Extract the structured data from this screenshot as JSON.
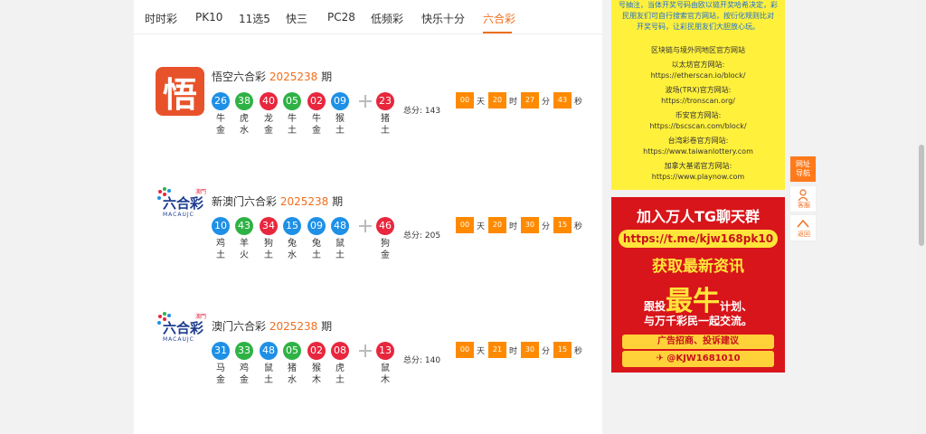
{
  "tabs": [
    {
      "label": "时时彩"
    },
    {
      "label": "PK10"
    },
    {
      "label": "11选5"
    },
    {
      "label": "快三"
    },
    {
      "label": "PC28"
    },
    {
      "label": "低频彩"
    },
    {
      "label": "快乐十分"
    },
    {
      "label": "六合彩"
    }
  ],
  "lotteries": [
    {
      "logo": "悟",
      "name": "悟空六合彩",
      "issue": "2025238",
      "period_label": "期",
      "balls": [
        {
          "num": "26",
          "color": "blue",
          "zodiac": "牛",
          "element": "金"
        },
        {
          "num": "38",
          "color": "green",
          "zodiac": "虎",
          "element": "水"
        },
        {
          "num": "40",
          "color": "red",
          "zodiac": "龙",
          "element": "金"
        },
        {
          "num": "05",
          "color": "green",
          "zodiac": "牛",
          "element": "土"
        },
        {
          "num": "02",
          "color": "red",
          "zodiac": "牛",
          "element": "金"
        },
        {
          "num": "09",
          "color": "blue",
          "zodiac": "猴",
          "element": "土"
        }
      ],
      "special": {
        "num": "23",
        "color": "red",
        "zodiac": "猪",
        "element": "土"
      },
      "total": "总分: 143",
      "countdown": {
        "d": "00",
        "d_u": "天",
        "h": "20",
        "h_u": "时",
        "m": "27",
        "m_u": "分",
        "s": "43",
        "s_u": "秒"
      }
    },
    {
      "logo_text": "六合彩",
      "logo_sub": "MACAUJC",
      "logo_tag": "澳門",
      "name": "新澳门六合彩",
      "issue": "2025238",
      "period_label": "期",
      "balls": [
        {
          "num": "10",
          "color": "blue",
          "zodiac": "鸡",
          "element": "土"
        },
        {
          "num": "43",
          "color": "green",
          "zodiac": "羊",
          "element": "火"
        },
        {
          "num": "34",
          "color": "red",
          "zodiac": "狗",
          "element": "土"
        },
        {
          "num": "15",
          "color": "blue",
          "zodiac": "兔",
          "element": "水"
        },
        {
          "num": "09",
          "color": "blue",
          "zodiac": "兔",
          "element": "土"
        },
        {
          "num": "48",
          "color": "blue",
          "zodiac": "鼠",
          "element": "土"
        }
      ],
      "special": {
        "num": "46",
        "color": "red",
        "zodiac": "狗",
        "element": "金"
      },
      "total": "总分: 205",
      "countdown": {
        "d": "00",
        "d_u": "天",
        "h": "20",
        "h_u": "时",
        "m": "30",
        "m_u": "分",
        "s": "15",
        "s_u": "秒"
      }
    },
    {
      "logo_text": "六合彩",
      "logo_sub": "MACAUJC",
      "logo_tag": "澳門",
      "name": "澳门六合彩",
      "issue": "2025238",
      "period_label": "期",
      "balls": [
        {
          "num": "31",
          "color": "blue",
          "zodiac": "马",
          "element": "金"
        },
        {
          "num": "33",
          "color": "green",
          "zodiac": "鸡",
          "element": "金"
        },
        {
          "num": "48",
          "color": "blue",
          "zodiac": "鼠",
          "element": "土"
        },
        {
          "num": "05",
          "color": "green",
          "zodiac": "猪",
          "element": "水"
        },
        {
          "num": "02",
          "color": "red",
          "zodiac": "猴",
          "element": "木"
        },
        {
          "num": "08",
          "color": "red",
          "zodiac": "虎",
          "element": "土"
        }
      ],
      "special": {
        "num": "13",
        "color": "red",
        "zodiac": "鼠",
        "element": "木"
      },
      "total": "总分: 140",
      "countdown": {
        "d": "00",
        "d_u": "天",
        "h": "21",
        "h_u": "时",
        "m": "30",
        "m_u": "分",
        "s": "15",
        "s_u": "秒"
      }
    }
  ],
  "notice": {
    "top_lines": [
      "号抽注，当体开奖号码由欧以链开奖哈希决定，彩",
      "民朋友们可自行搜索官方网站，按衍化规则比对",
      "开奖号码，让彩民朋友们大胆放心玩。"
    ],
    "heading": "区块链与境外同地区官方网站",
    "sites": [
      {
        "label": "以太坊官方网站:",
        "url": "https://etherscan.io/block/"
      },
      {
        "label": "波场(TRX)官方网站:",
        "url": "https://tronscan.org/"
      },
      {
        "label": "币安官方网站:",
        "url": "https://bscscan.com/block/"
      },
      {
        "label": "台湾彩卷官方网站:",
        "url": "https://www.taiwanlottery.com"
      },
      {
        "label": "加拿大基诺官方网站:",
        "url": "https://www.playnow.com"
      }
    ]
  },
  "banner": {
    "title": "加入万人TG聊天群",
    "url": "https://t.me/kjw168pk10",
    "line2": "获取最新资讯",
    "line3_a": "跟投",
    "line3_big": "最牛",
    "line3_b": "计划、",
    "line4": "与万千彩民一起交流。",
    "ad": "广告招商、投诉建议",
    "tg": "@KJW1681010"
  },
  "side": {
    "nav": "网址导航",
    "service": "客服",
    "top": "返回"
  },
  "colors": {
    "accent": "#f06f1e",
    "blue": "#1e90e6",
    "green": "#2fb245",
    "red": "#e8263d",
    "countdown": "#ff8a00"
  }
}
